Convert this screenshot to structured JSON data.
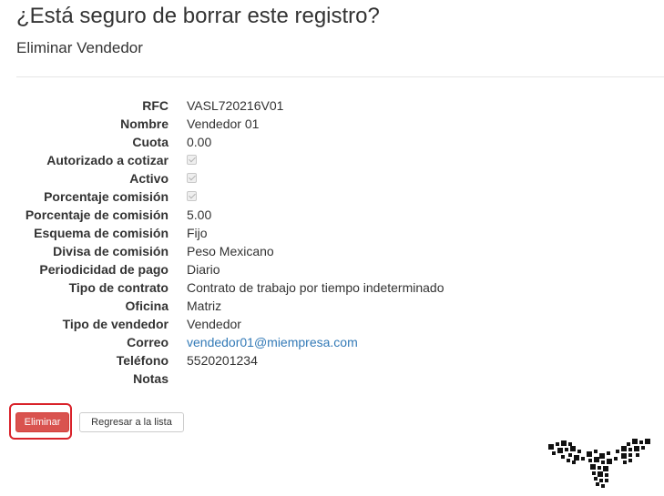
{
  "page": {
    "title": "¿Está seguro de borrar este registro?",
    "subtitle": "Eliminar Vendedor"
  },
  "details": [
    {
      "label": "RFC",
      "value": "VASL720216V01"
    },
    {
      "label": "Nombre",
      "value": "Vendedor 01"
    },
    {
      "label": "Cuota",
      "value": "0.00"
    },
    {
      "label": "Autorizado a cotizar",
      "checked": true
    },
    {
      "label": "Activo",
      "checked": true
    },
    {
      "label": "Porcentaje comisión",
      "checked": true
    },
    {
      "label": "Porcentaje de comisión",
      "value": "5.00"
    },
    {
      "label": "Esquema de comisión",
      "value": "Fijo"
    },
    {
      "label": "Divisa de comisión",
      "value": "Peso Mexicano"
    },
    {
      "label": "Periodicidad de pago",
      "value": "Diario"
    },
    {
      "label": "Tipo de contrato",
      "value": "Contrato de trabajo por tiempo indeterminado"
    },
    {
      "label": "Oficina",
      "value": "Matriz"
    },
    {
      "label": "Tipo de vendedor",
      "value": "Vendedor"
    },
    {
      "label": "Correo",
      "value": "vendedor01@miempresa.com"
    },
    {
      "label": "Teléfono",
      "value": "5520201234"
    },
    {
      "label": "Notas",
      "value": ""
    }
  ],
  "actions": {
    "delete_label": "Eliminar",
    "back_label": "Regresar a la lista"
  },
  "colors": {
    "danger": "#d9534f",
    "highlight": "#d9222a",
    "link": "#337ab7"
  },
  "icons": {
    "logo": "qr-pattern-bird-logo"
  }
}
